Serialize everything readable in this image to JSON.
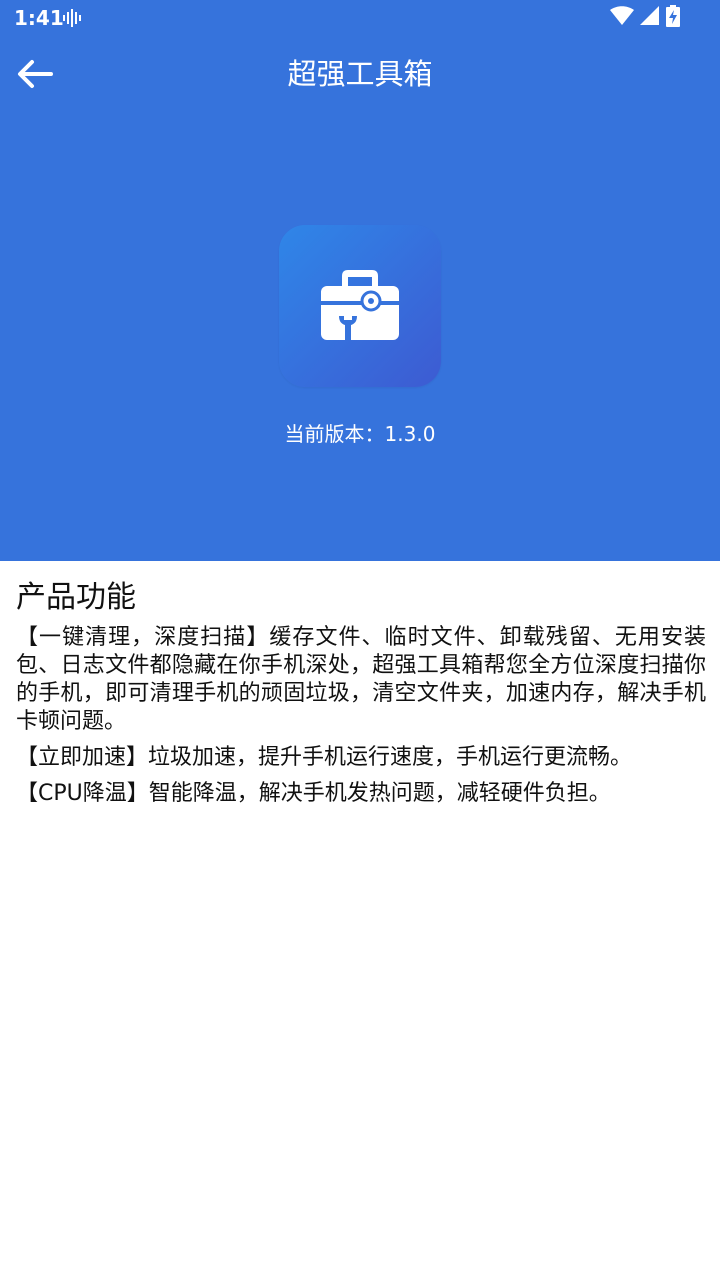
{
  "status_bar": {
    "time": "1:41"
  },
  "toolbar": {
    "title": "超强工具箱"
  },
  "app": {
    "version_label": "当前版本：1.3.0"
  },
  "features": {
    "title": "产品功能",
    "paragraphs": [
      "【一键清理，深度扫描】缓存文件、临时文件、卸载残留、无用安装包、日志文件都隐藏在你手机深处，超强工具箱帮您全方位深度扫描你的手机，即可清理手机的顽固垃圾，清空文件夹，加速内存，解决手机卡顿问题。",
      "【立即加速】垃圾加速，提升手机运行速度，手机运行更流畅。",
      "【CPU降温】智能降温，解决手机发热问题，减轻硬件负担。"
    ]
  },
  "colors": {
    "primary": "#3673DC",
    "icon_gradient_start": "#2F86E8",
    "icon_gradient_end": "#3D5BD2",
    "text": "#111111"
  },
  "icons": {
    "back": "arrow-left-icon",
    "app": "toolbox-icon",
    "voice": "voice-wave-icon",
    "wifi": "wifi-icon",
    "signal": "signal-icon",
    "battery": "battery-charging-icon"
  }
}
